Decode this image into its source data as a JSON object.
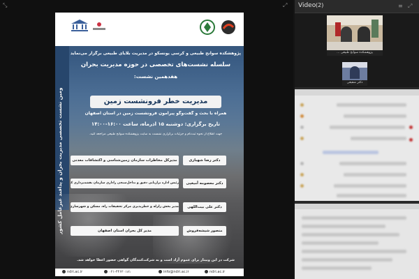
{
  "window": {
    "video_label": "Video",
    "video_count": "(2)"
  },
  "poster": {
    "sidebar_text": "شصت‌وسومین نشست تخصصی مدیریت بحران و پدافند غیرعامل کشور",
    "line1": "پژوهشکده سوانح طبیعی و کرسی یونسکو در مدیریت بلایای طبیعی برگزار می‌نماید:",
    "line2": "سلسله نشست‌های تخصصی در حوزه مدیریت بحران",
    "line3": "هفدهمین نشست:",
    "title": "مدیریت خطر فرونشست زمین",
    "subtitle": "همراه با بحث و گفت‌وگو پیرامون فرونشست زمین در استان اصفهان",
    "date": "تاریخ برگزاری: دوشنبه ۱۵ آذرماه، ساعت ۱۶:۰۰-۱۴:۰۰",
    "info": "جهت اطلاع از نحوه ثبت‌نام و جزئیات برگزاری نشست به سایت پژوهشکده سوانح طبیعی مراجعه کنید.",
    "speakers": [
      {
        "name": "دکتر رضا شهبازی",
        "role": "مدیرکل مخاطرات سازمان زمین‌شناسی و اکتشافات معدنی"
      },
      {
        "name": "دکتر معصومه آمیغپی",
        "role": "رئیس اداره ترازیابی دقیق و تداخل‌سنجی راداری سازمان نقشه‌برداری کشور"
      },
      {
        "name": "دکتر علی بیت‌اللهی",
        "role": "مدیر بخش زلزله و خطرپذیری مرکز تحقیقات راه، مسکن و شهرسازی"
      },
      {
        "name": "منصور شیشه‌فروش",
        "role": "مدیر کل بحران استان اصفهان"
      }
    ],
    "footer_note": "شرکت در این وبینار برای عموم آزاد است و به شرکت‌کنندگان گواهی حضور اعطا خواهد شد.",
    "contacts": {
      "site_left": "ndri.ac.ir",
      "phone": "۰۲۱-۴۴۶۲۰۱۸۱",
      "email": "info@ndri.ac.ir",
      "site_right": "ndri.ac.ir"
    }
  },
  "video": {
    "tile1_label": "پژوهشکده سوانح طبیعی ...",
    "tile2_label": "دکتر شفیعی"
  }
}
